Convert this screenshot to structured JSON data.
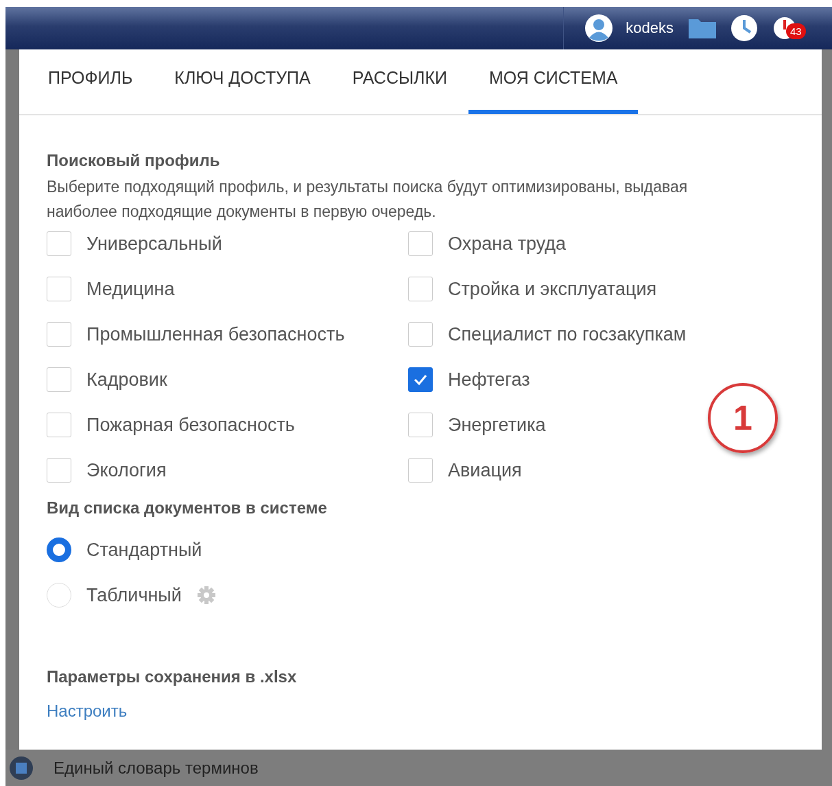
{
  "header": {
    "user": "kodeks",
    "badge": "43"
  },
  "tabs": [
    {
      "label": "ПРОФИЛЬ",
      "selected": false
    },
    {
      "label": "КЛЮЧ ДОСТУПА",
      "selected": false
    },
    {
      "label": "РАССЫЛКИ",
      "selected": false
    },
    {
      "label": "МОЯ СИСТЕМА",
      "selected": true
    }
  ],
  "search_profile": {
    "title": "Поисковый профиль",
    "description": "Выберите подходящий профиль, и результаты поиска будут оптимизированы, выдавая наиболее подходящие документы в первую очередь.",
    "options": [
      {
        "label": "Универсальный",
        "checked": false
      },
      {
        "label": "Охрана труда",
        "checked": false
      },
      {
        "label": "Медицина",
        "checked": false
      },
      {
        "label": "Стройка и эксплуатация",
        "checked": false
      },
      {
        "label": "Промышленная безопасность",
        "checked": false
      },
      {
        "label": "Специалист по госзакупкам",
        "checked": false
      },
      {
        "label": "Кадровик",
        "checked": false
      },
      {
        "label": "Нефтегаз",
        "checked": true
      },
      {
        "label": "Пожарная безопасность",
        "checked": false
      },
      {
        "label": "Энергетика",
        "checked": false
      },
      {
        "label": "Экология",
        "checked": false
      },
      {
        "label": "Авиация",
        "checked": false
      }
    ]
  },
  "list_view": {
    "title": "Вид списка документов в системе",
    "options": [
      {
        "label": "Стандартный",
        "selected": true,
        "settings": false
      },
      {
        "label": "Табличный",
        "selected": false,
        "settings": true
      }
    ]
  },
  "export": {
    "title": "Параметры сохранения в .xlsx",
    "link": "Настроить"
  },
  "annotation": {
    "label": "1"
  },
  "background_item": {
    "label": "Единый словарь терминов"
  }
}
